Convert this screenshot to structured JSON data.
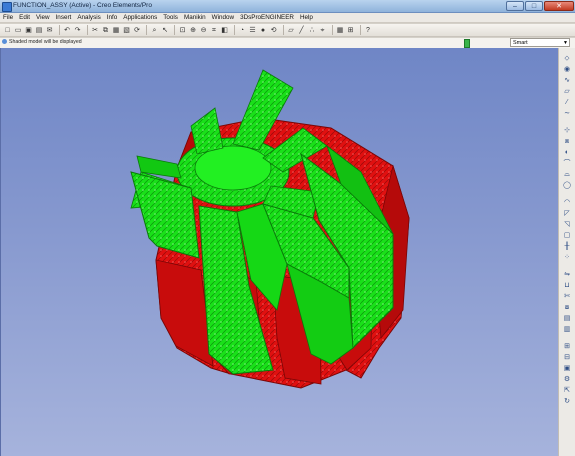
{
  "window": {
    "title": "FUNCTION_ASSY (Active) - Creo Elements/Pro",
    "min_label": "–",
    "max_label": "□",
    "close_label": "✕"
  },
  "menu": {
    "items": [
      "File",
      "Edit",
      "View",
      "Insert",
      "Analysis",
      "Info",
      "Applications",
      "Tools",
      "Manikin",
      "Window",
      "3DsProENGINEER",
      "Help"
    ],
    "help_icon_label": "?"
  },
  "toolbar": {
    "icons": [
      "new-icon",
      "open-icon",
      "save-icon",
      "print-icon",
      "email-icon",
      "undo-icon",
      "redo-icon",
      "cut-icon",
      "copy-icon",
      "paste-icon",
      "paste-special-icon",
      "regenerate-icon",
      "find-icon",
      "select-icon",
      "refit-icon",
      "zoom-in-icon",
      "zoom-out-icon",
      "repaint-icon",
      "orient-icon",
      "saved-views-icon",
      "layers-icon",
      "shading-icon",
      "spin-icon",
      "datum-planes-icon",
      "datum-axes-icon",
      "datum-points-icon",
      "csys-icon",
      "model-tree-icon",
      "annotation-icon",
      "help-whats-this-icon"
    ],
    "glyphs": [
      "□",
      "▭",
      "▣",
      "▤",
      "✉",
      "↶",
      "↷",
      "✂",
      "⧉",
      "▦",
      "▧",
      "⟳",
      "⌕",
      "↖",
      "⊡",
      "⊕",
      "⊖",
      "⌗",
      "◧",
      "◔",
      "☰",
      "●",
      "⟲",
      "▱",
      "╱",
      "∴",
      "⌖",
      "▦",
      "⊞",
      "?"
    ]
  },
  "status": {
    "message": "Shaded model will be displayed",
    "filter_value": "Smart"
  },
  "right_toolbar": {
    "icons": [
      "datum-plane-tool-icon",
      "datum-axis-tool-icon",
      "datum-curve-icon",
      "sketch-icon",
      "datum-point-icon",
      "csys-tool-icon",
      "analysis-icon",
      "extrude-icon",
      "revolve-icon",
      "sweep-icon",
      "blend-icon",
      "hole-icon",
      "round-icon",
      "chamfer-icon",
      "draft-icon",
      "shell-icon",
      "rib-icon",
      "pattern-icon",
      "mirror-icon",
      "merge-icon",
      "trim-icon",
      "offset-icon",
      "thicken-icon",
      "solidify-icon",
      "assemble-icon",
      "create-component-icon",
      "package-icon",
      "mechanism-icon",
      "explode-icon",
      "repeat-icon"
    ],
    "glyphs": [
      "⬦",
      "◉",
      "∿",
      "▱",
      "⁄",
      "∼",
      "⊹",
      "⧈",
      "◐",
      "⌒",
      "⌓",
      "◯",
      "◠",
      "◸",
      "◹",
      "▢",
      "╫",
      "⁘",
      "⇋",
      "⊔",
      "✄",
      "⧇",
      "▤",
      "▥",
      "⊞",
      "⊟",
      "▣",
      "⚙",
      "⇱",
      "↻"
    ]
  },
  "viewport": {
    "background_top": "#6f86c6",
    "background_bottom": "#a6b3dc",
    "model": {
      "name": "FUNCTION_ASSY",
      "colors": {
        "red": "#e01010",
        "red_dark": "#a50b0b",
        "green": "#19e019",
        "green_dark": "#0fa00f"
      }
    }
  }
}
